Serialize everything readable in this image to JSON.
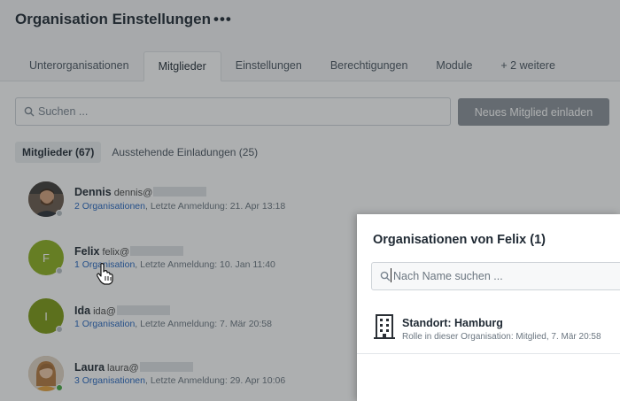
{
  "header": {
    "title": "Organisation Einstellungen",
    "more": "•••",
    "tabs": [
      {
        "label": "Unterorganisationen"
      },
      {
        "label": "Mitglieder"
      },
      {
        "label": "Einstellungen"
      },
      {
        "label": "Berechtigungen"
      },
      {
        "label": "Module"
      },
      {
        "label": "+ 2 weitere"
      }
    ]
  },
  "toolbar": {
    "search_placeholder": "Suchen ...",
    "invite_label": "Neues Mitglied einladen"
  },
  "subtabs": [
    {
      "label": "Mitglieder (67)"
    },
    {
      "label": "Ausstehende Einladungen (25)"
    }
  ],
  "members": [
    {
      "name": "Dennis",
      "email": "dennis@",
      "orgs": "2 Organisationen",
      "last_login": ", Letzte Anmeldung: 21. Apr 13:18",
      "status": "offline"
    },
    {
      "name": "Felix",
      "email": "felix@",
      "initial": "F",
      "orgs": "1 Organisation",
      "last_login": ", Letzte Anmeldung: 10. Jan 11:40",
      "status": "offline"
    },
    {
      "name": "Ida",
      "email": "ida@",
      "initial": "I",
      "orgs": "1 Organisation",
      "last_login": ", Letzte Anmeldung: 7. Mär 20:58",
      "status": "offline"
    },
    {
      "name": "Laura",
      "email": "laura@",
      "orgs": "3 Organisationen",
      "last_login": ", Letzte Anmeldung: 29. Apr 10:06",
      "status": "online"
    }
  ],
  "panel": {
    "title": "Organisationen von Felix (1)",
    "search_placeholder": "Nach Name suchen ...",
    "orgs": [
      {
        "name": "Standort: Hamburg",
        "role": "Rolle in dieser Organisation: Mitglied, 7. Mär 20:58"
      }
    ]
  },
  "colors": {
    "link": "#2566c0",
    "online": "#47a842",
    "avatar_green": "#8db11d",
    "button_gray": "#8b9299"
  }
}
